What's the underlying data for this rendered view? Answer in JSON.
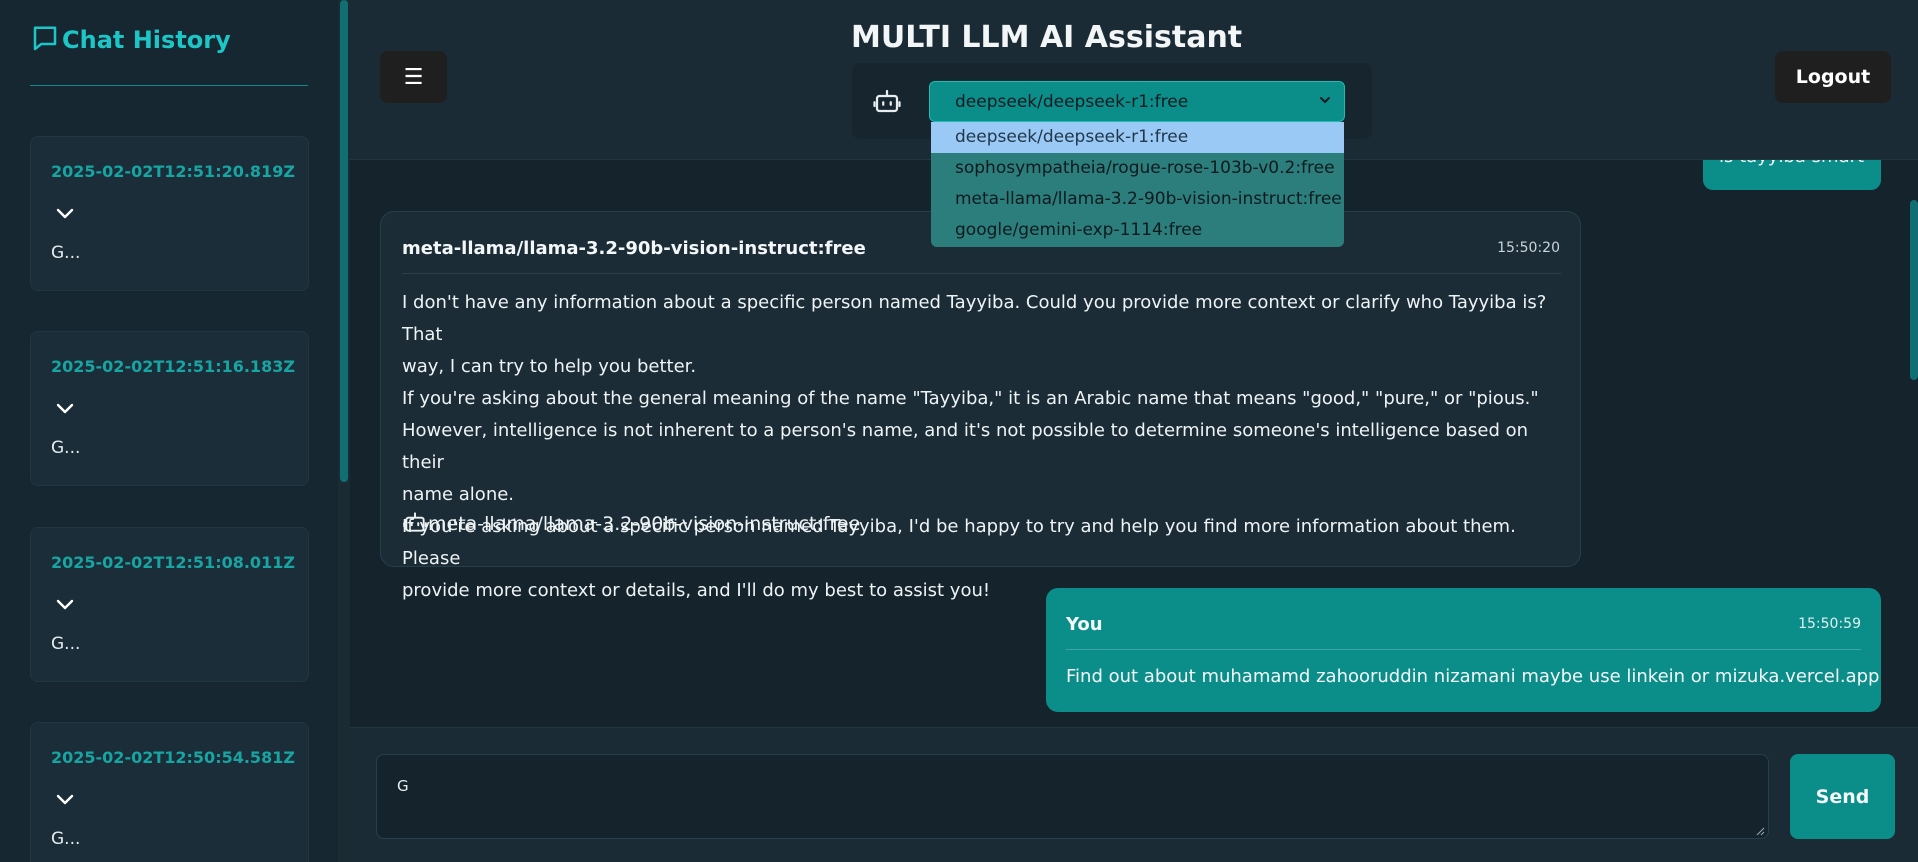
{
  "sidebar": {
    "title": "Chat History",
    "title_icon": "chat-bubble-icon",
    "items": [
      {
        "timestamp": "2025-02-02T12:51:20.819Z",
        "preview": "G..."
      },
      {
        "timestamp": "2025-02-02T12:51:16.183Z",
        "preview": "G..."
      },
      {
        "timestamp": "2025-02-02T12:51:08.011Z",
        "preview": "G..."
      },
      {
        "timestamp": "2025-02-02T12:50:54.581Z",
        "preview": "G..."
      }
    ]
  },
  "header": {
    "menu_label": "☰",
    "title": "MULTI LLM AI Assistant",
    "logout_label": "Logout"
  },
  "model_select": {
    "selected": "deepseek/deepseek-r1:free",
    "options": [
      "deepseek/deepseek-r1:free",
      "sophosympatheia/rogue-rose-103b-v0.2:free",
      "meta-llama/llama-3.2-90b-vision-instruct:free",
      "google/gemini-exp-1114:free"
    ]
  },
  "messages": {
    "partial_user_text": "is tayyiba smart",
    "bot": {
      "model": "meta-llama/llama-3.2-90b-vision-instruct:free",
      "time": "15:50:20",
      "lines": [
        "I don't have any information about a specific person named Tayyiba. Could you provide more context or clarify who Tayyiba is? That",
        "way, I can try to help you better.",
        "If you're asking about the general meaning of the name \"Tayyiba,\" it is an Arabic name that means \"good,\" \"pure,\" or \"pious.\"",
        "However, intelligence is not inherent to a person's name, and it's not possible to determine someone's intelligence based on their",
        "name alone.",
        "If you're asking about a specific person named Tayyiba, I'd be happy to try and help you find more information about them. Please",
        "provide more context or details, and I'll do my best to assist you!"
      ],
      "footer_model": "meta-llama/llama-3.2-90b-vision-instruct:free"
    },
    "user": {
      "who": "You",
      "time": "15:50:59",
      "text": "Find out about muhamamd zahooruddin nizamani maybe use linkein or mizuka.vercel.app"
    }
  },
  "composer": {
    "value": "G",
    "send_label": "Send"
  },
  "colors": {
    "accent": "#0b8e8a",
    "sidebar_title": "#1dc6c6",
    "background": "#15232c"
  }
}
